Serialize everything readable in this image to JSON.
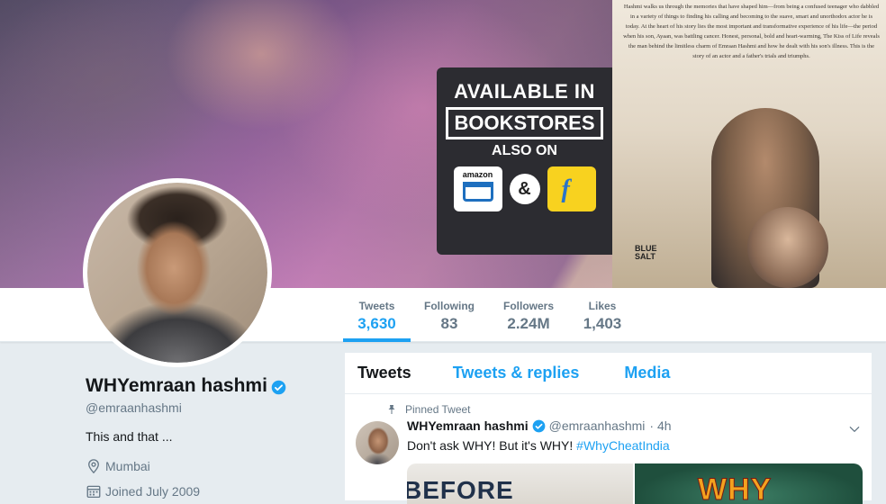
{
  "banner": {
    "book_blurb": "Hashmi walks us through the memories that have shaped him—from being a confused teenager who dabbled in a variety of things to finding his calling and becoming to the suave, smart and unorthodox actor he is today. At the heart of his story lies the most important and transformative experience of his life—the period when his son, Ayaan, was battling cancer. Honest, personal, bold and heart-warming, The Kiss of Life reveals the man behind the limitless charm of Emraan Hashmi and how he dealt with his son's illness. This is the story of an actor and a father's trials and triumphs.",
    "line1": "AVAILABLE IN",
    "line2": "BOOKSTORES",
    "line3": "ALSO ON",
    "amazon": "amazon",
    "amp": "&",
    "flipkart": "f",
    "publisher": "BLUE\nSALT"
  },
  "stats": [
    {
      "label": "Tweets",
      "value": "3,630"
    },
    {
      "label": "Following",
      "value": "83"
    },
    {
      "label": "Followers",
      "value": "2.24M"
    },
    {
      "label": "Likes",
      "value": "1,403"
    }
  ],
  "profile": {
    "name": "WHYemraan hashmi",
    "handle": "@emraanhashmi",
    "bio": "This and that ...",
    "location": "Mumbai",
    "joined": "Joined July 2009"
  },
  "timeline": {
    "tabs": [
      "Tweets",
      "Tweets & replies",
      "Media"
    ],
    "pinned_label": "Pinned Tweet",
    "tweet": {
      "name": "WHYemraan hashmi",
      "handle": "@emraanhashmi",
      "time": "· 4h",
      "text": "Don't ask WHY! But it's WHY!",
      "hashtag": "#WhyCheatIndia",
      "media_left": "BEFORE",
      "media_right": "WHY"
    }
  },
  "colors": {
    "accent": "#1da1f2",
    "muted": "#657786",
    "text": "#14171a",
    "background": "#e6ecf0"
  }
}
